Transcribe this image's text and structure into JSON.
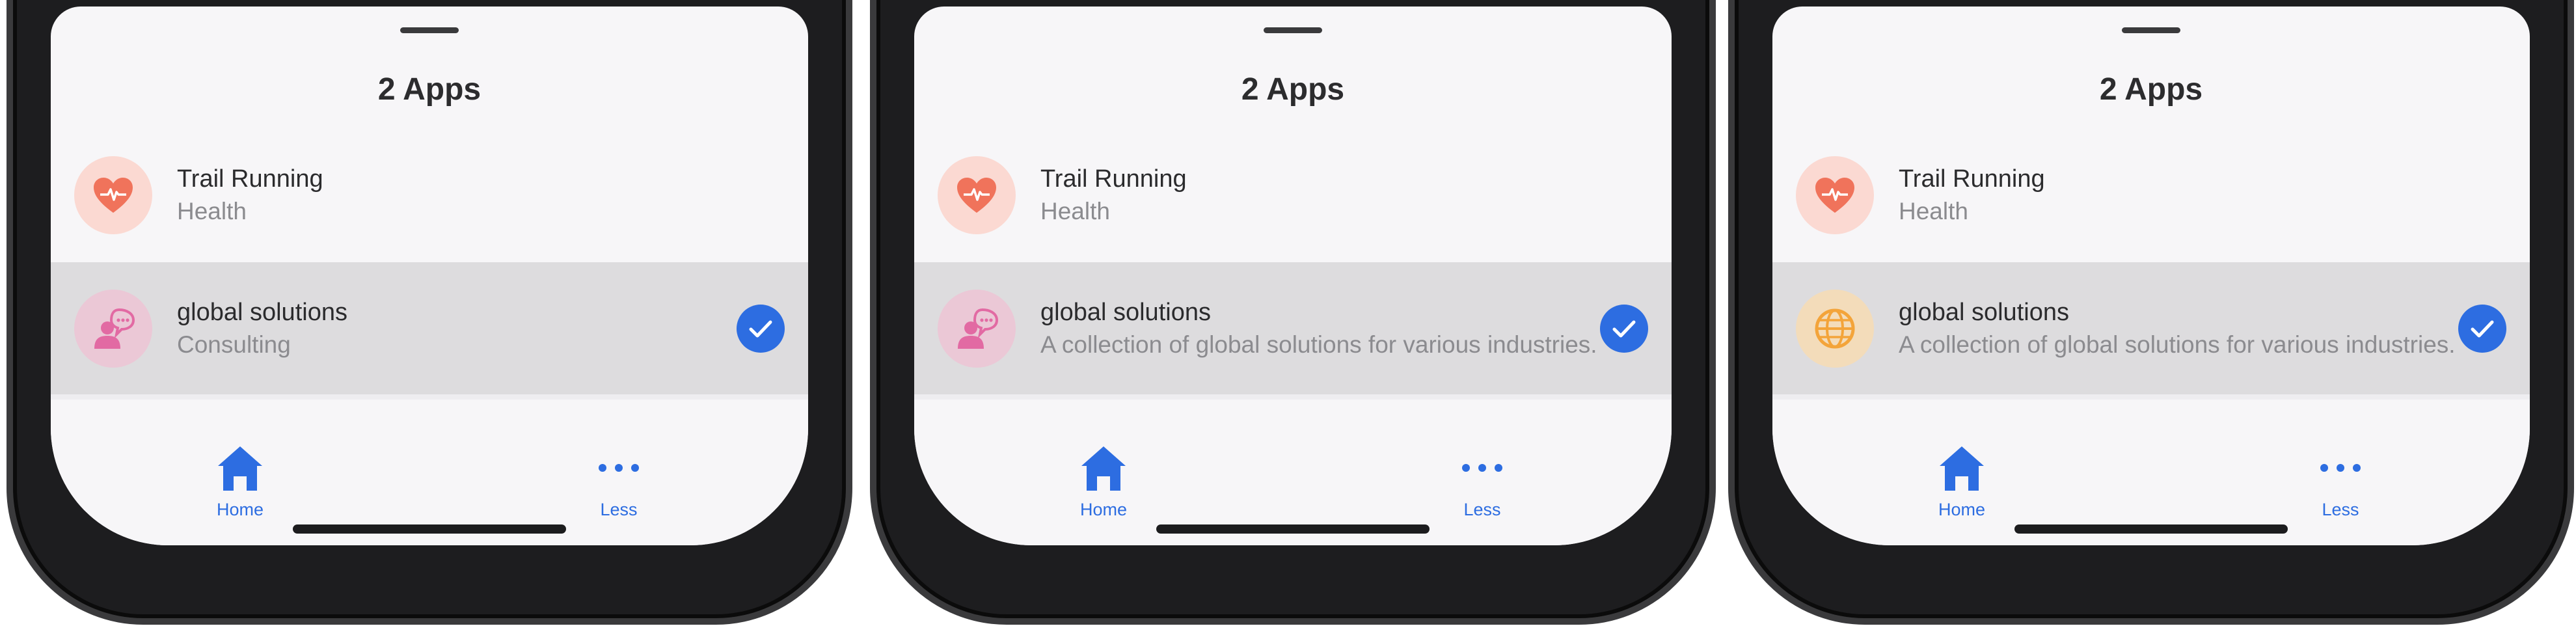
{
  "screens": [
    {
      "sheet_title": "2 Apps",
      "apps": [
        {
          "name": "Trail Running",
          "subtitle": "Health",
          "icon": "heart-pulse-icon",
          "selected": false
        },
        {
          "name": "global solutions",
          "subtitle": "Consulting",
          "icon": "person-speech-icon",
          "selected": true
        }
      ],
      "tabs": [
        {
          "label": "Home",
          "icon": "house-icon"
        },
        {
          "label": "Less",
          "icon": "ellipsis-icon"
        }
      ]
    },
    {
      "sheet_title": "2 Apps",
      "apps": [
        {
          "name": "Trail Running",
          "subtitle": "Health",
          "icon": "heart-pulse-icon",
          "selected": false
        },
        {
          "name": "global solutions",
          "subtitle": "A collection of global solutions for various industries.",
          "icon": "person-speech-icon",
          "selected": true
        }
      ],
      "tabs": [
        {
          "label": "Home",
          "icon": "house-icon"
        },
        {
          "label": "Less",
          "icon": "ellipsis-icon"
        }
      ]
    },
    {
      "sheet_title": "2 Apps",
      "apps": [
        {
          "name": "Trail Running",
          "subtitle": "Health",
          "icon": "heart-pulse-icon",
          "selected": false
        },
        {
          "name": "global solutions",
          "subtitle": "A collection of global solutions for various industries.",
          "icon": "globe-icon",
          "selected": true
        }
      ],
      "tabs": [
        {
          "label": "Home",
          "icon": "house-icon"
        },
        {
          "label": "Less",
          "icon": "ellipsis-icon"
        }
      ]
    }
  ],
  "colors": {
    "accent": "#2d6de1",
    "heart_bg": "#fbd9d2",
    "heart": "#f0735b",
    "consult_bg": "#ebc8d6",
    "consult": "#e26aa3",
    "globe_bg": "#f3dcba",
    "globe": "#f3a43a",
    "selected_row": "#dddcde"
  }
}
